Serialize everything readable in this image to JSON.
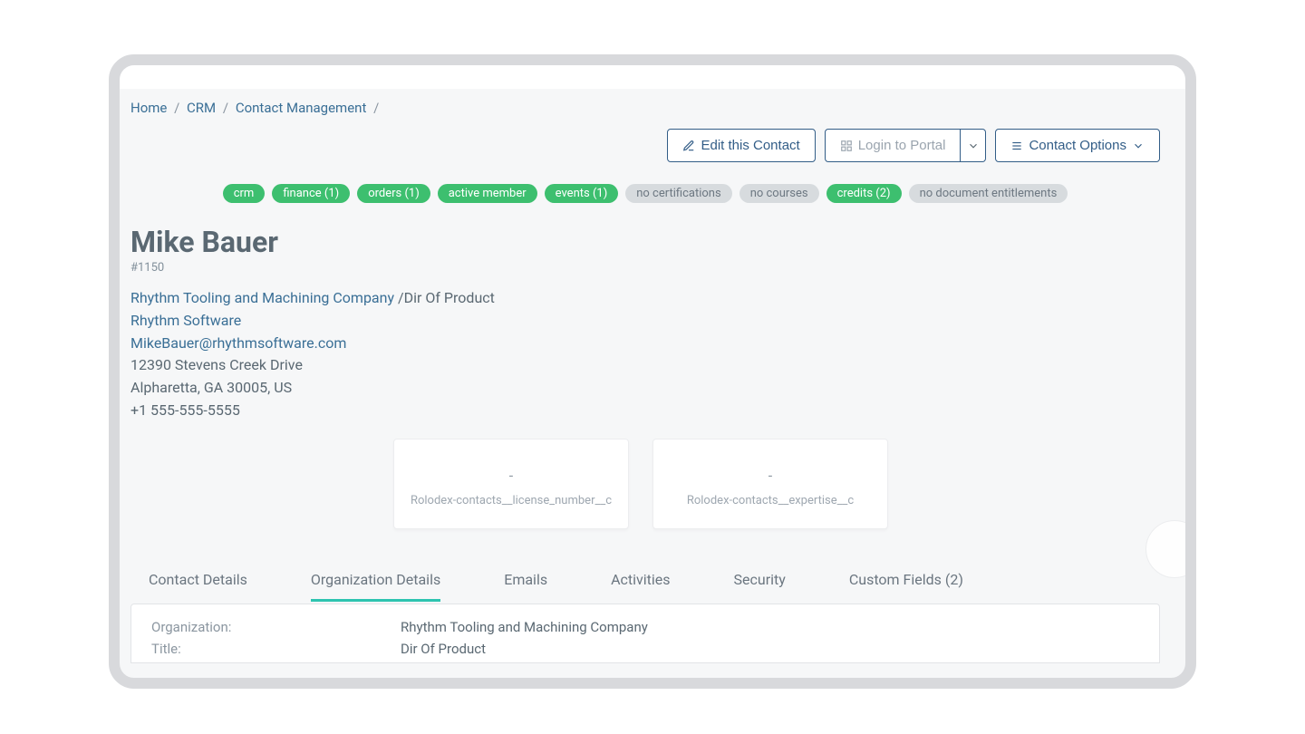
{
  "breadcrumb": {
    "home": "Home",
    "crm": "CRM",
    "contact_mgmt": "Contact Management"
  },
  "actions": {
    "edit": "Edit this Contact",
    "login": "Login to Portal",
    "options": "Contact Options"
  },
  "pills": {
    "crm": "crm",
    "finance": "finance (1)",
    "orders": "orders (1)",
    "active_member": "active member",
    "events": "events (1)",
    "no_cert": "no certifications",
    "no_courses": "no courses",
    "credits": "credits (2)",
    "no_doc": "no document entitlements"
  },
  "contact": {
    "name": "Mike Bauer",
    "id": "#1150",
    "org_link": "Rhythm Tooling and Machining Company",
    "role_sep": " /",
    "role": "Dir Of Product",
    "company_link": "Rhythm Software",
    "email": "MikeBauer@rhythmsoftware.com",
    "addr1": "12390 Stevens Creek Drive",
    "addr2": "Alpharetta, GA 30005, US",
    "phone": "+1 555-555-5555"
  },
  "cards": [
    {
      "value": "-",
      "label": "Rolodex-contacts__license_number__c"
    },
    {
      "value": "-",
      "label": "Rolodex-contacts__expertise__c"
    }
  ],
  "tabs": {
    "contact_details": "Contact Details",
    "org_details": "Organization Details",
    "emails": "Emails",
    "activities": "Activities",
    "security": "Security",
    "custom_fields": "Custom Fields (2)"
  },
  "panel": {
    "org_k": "Organization:",
    "org_v": "Rhythm Tooling and Machining Company",
    "title_k": "Title:",
    "title_v": "Dir Of Product"
  }
}
